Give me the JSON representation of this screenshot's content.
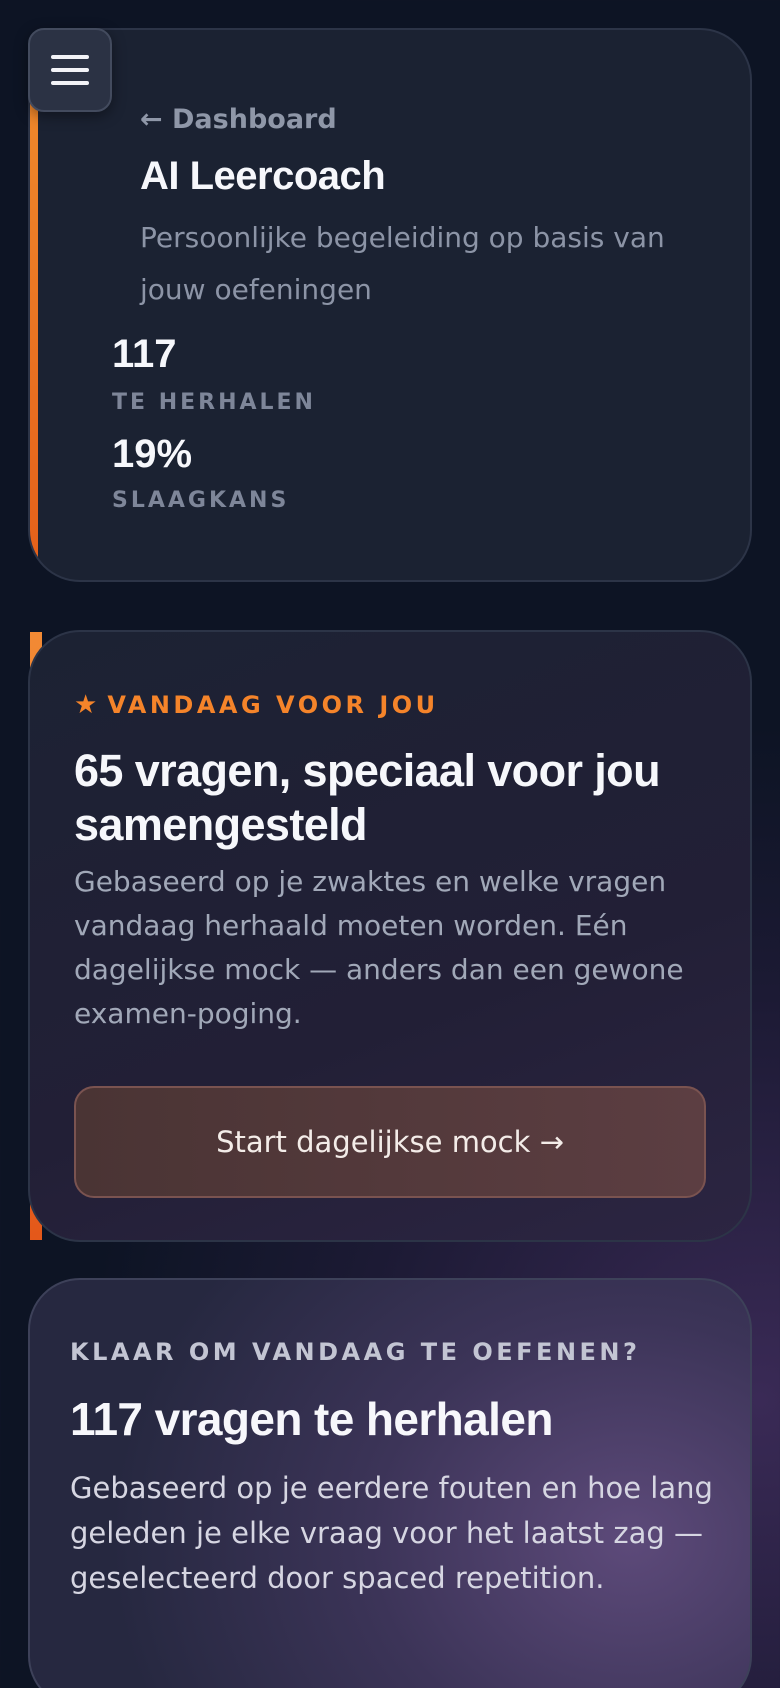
{
  "header": {
    "back_label": "← Dashboard",
    "title": "AI Leercoach",
    "subtitle": "Persoonlijke begeleiding op basis van jouw oefeningen",
    "stats": [
      {
        "value": "117",
        "label": "TE HERHALEN"
      },
      {
        "value": "19%",
        "label": "SLAAGKANS"
      }
    ]
  },
  "today": {
    "label": "VANDAAG VOOR JOU",
    "title": "65 vragen, speciaal voor jou samengesteld",
    "description": "Gebaseerd op je zwaktes en welke vragen vandaag herhaald moeten worden. Eén dagelijkse mock — anders dan een gewone examen-poging.",
    "button_label": "Start dagelijkse mock →"
  },
  "review": {
    "label": "KLAAR OM VANDAAG TE OEFENEN?",
    "title": "117 vragen te herhalen",
    "description": "Gebaseerd op je eerdere fouten en hoe lang geleden je elke vraag voor het laatst zag — geselecteerd door spaced repetition."
  },
  "icons": {
    "menu": "hamburger-menu-icon",
    "star": "star-icon"
  },
  "colors": {
    "accent": "#f5842a",
    "background": "#0d1424",
    "card": "#1b2232"
  }
}
